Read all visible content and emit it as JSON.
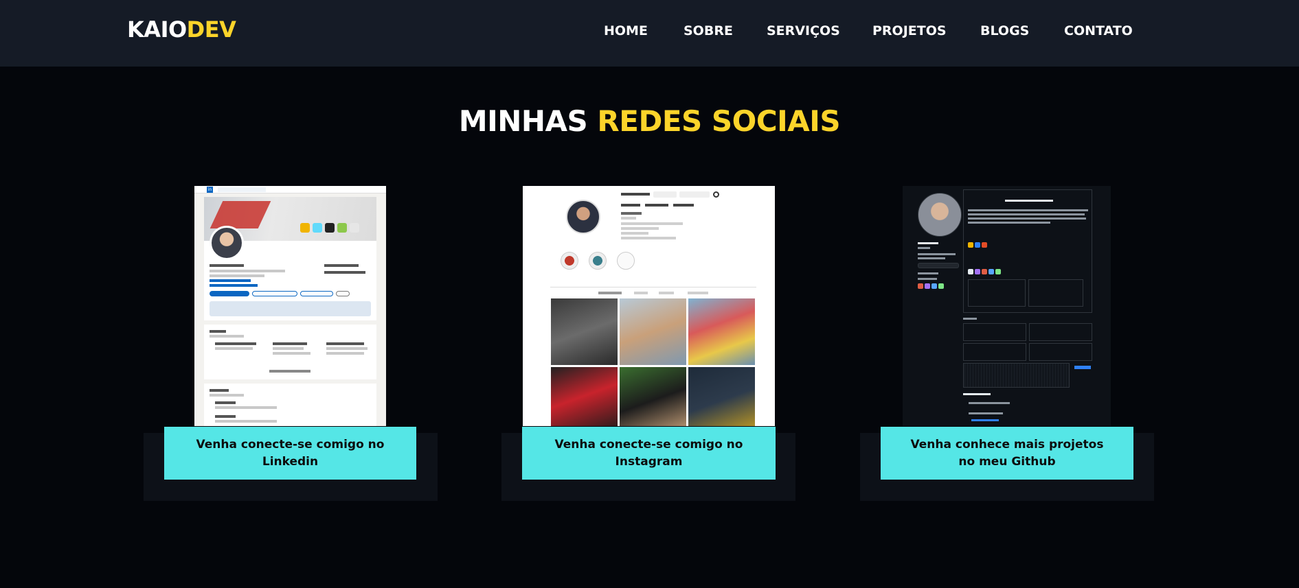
{
  "header": {
    "logo_main": "KAIO",
    "logo_accent": "DEV",
    "nav": [
      {
        "label": "HOME"
      },
      {
        "label": "SOBRE"
      },
      {
        "label": "SERVIÇOS"
      },
      {
        "label": "PROJETOS"
      },
      {
        "label": "BLOGS"
      },
      {
        "label": "CONTATO"
      }
    ]
  },
  "section": {
    "title_main": "MINHAS",
    "title_accent": "REDES SOCIAIS"
  },
  "cards": [
    {
      "name": "linkedin",
      "button_label": "Venha conecte-se comigo no Linkedin"
    },
    {
      "name": "instagram",
      "button_label": "Venha conecte-se comigo no Instagram"
    },
    {
      "name": "github",
      "button_label": "Venha conhece mais projetos no meu Github"
    }
  ],
  "colors": {
    "background": "#04060b",
    "header_bg": "#151b26",
    "accent_yellow": "#fcd42a",
    "button_cyan": "#55e6e6",
    "card_bg": "#0d1118"
  }
}
